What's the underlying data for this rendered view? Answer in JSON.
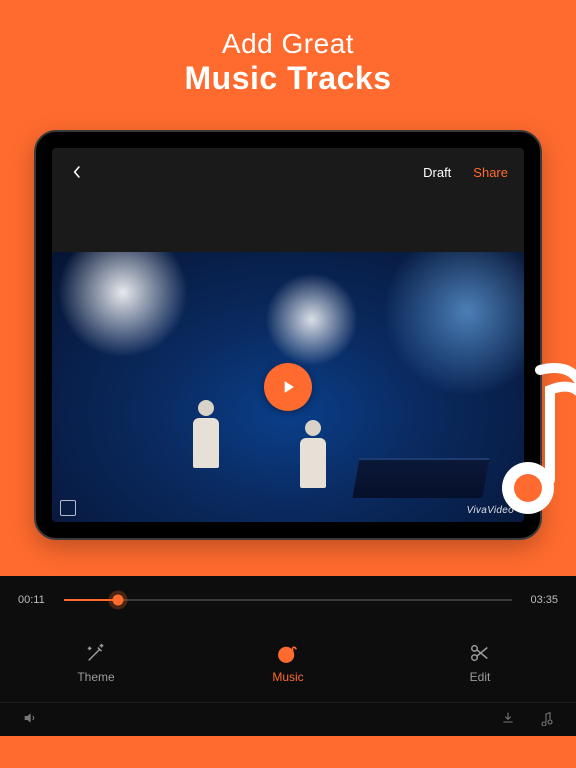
{
  "promo": {
    "line1": "Add Great",
    "line2": "Music Tracks"
  },
  "topbar": {
    "draft_label": "Draft",
    "share_label": "Share"
  },
  "video": {
    "watermark": "VivaVideo"
  },
  "timeline": {
    "current": "00:11",
    "total": "03:35",
    "progress_pct": 12
  },
  "tools": {
    "theme": "Theme",
    "music": "Music",
    "edit": "Edit"
  },
  "colors": {
    "accent": "#FF6B2E"
  }
}
